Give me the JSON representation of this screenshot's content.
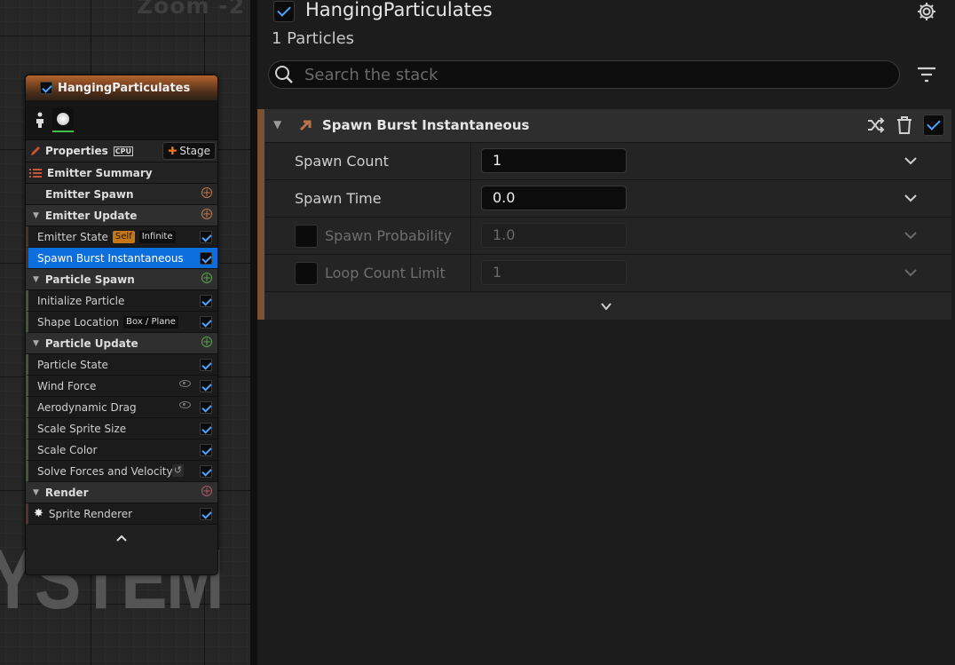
{
  "graph": {
    "zoom_label": "Zoom -2",
    "watermark": "YSTEM",
    "node": {
      "title": "HangingParticulates",
      "enabled": true,
      "properties_label": "Properties",
      "cpu_label": "CPU",
      "stage_button": "Stage",
      "rows": [
        {
          "kind": "plain",
          "label": "Emitter Summary"
        },
        {
          "kind": "plain",
          "label": "Emitter Spawn"
        },
        {
          "kind": "section",
          "label": "Emitter Update"
        },
        {
          "kind": "item",
          "label": "Emitter State",
          "badges": [
            "Self",
            "Infinite"
          ]
        },
        {
          "kind": "item",
          "label": "Spawn Burst Instantaneous",
          "selected": true
        },
        {
          "kind": "section",
          "label": "Particle Spawn"
        },
        {
          "kind": "item",
          "label": "Initialize Particle"
        },
        {
          "kind": "item",
          "label": "Shape Location",
          "badges": [
            "Box / Plane"
          ]
        },
        {
          "kind": "section",
          "label": "Particle Update"
        },
        {
          "kind": "item",
          "label": "Particle State"
        },
        {
          "kind": "item",
          "label": "Wind Force"
        },
        {
          "kind": "item",
          "label": "Aerodynamic Drag"
        },
        {
          "kind": "item",
          "label": "Scale Sprite Size"
        },
        {
          "kind": "item",
          "label": "Scale Color"
        },
        {
          "kind": "item",
          "label": "Solve Forces and Velocity"
        },
        {
          "kind": "section",
          "label": "Render"
        },
        {
          "kind": "item",
          "label": "Sprite Renderer"
        }
      ]
    }
  },
  "details": {
    "title": "HangingParticulates",
    "enabled": true,
    "subtitle": "1 Particles",
    "search_placeholder": "Search the stack",
    "module": {
      "title": "Spawn Burst Instantaneous",
      "enabled": true,
      "params": [
        {
          "label": "Spawn Count",
          "value": "1",
          "enabled": true
        },
        {
          "label": "Spawn Time",
          "value": "0.0",
          "enabled": true
        },
        {
          "label": "Spawn Probability",
          "value": "1.0",
          "enabled": false
        },
        {
          "label": "Loop Count Limit",
          "value": "1",
          "enabled": false
        }
      ]
    }
  },
  "colors": {
    "accent": "#0d6fde",
    "check": "#4aa3ff",
    "emitter_header": "#b4632c",
    "add_orange": "#f07a1c",
    "badge_self": "#c57617"
  }
}
